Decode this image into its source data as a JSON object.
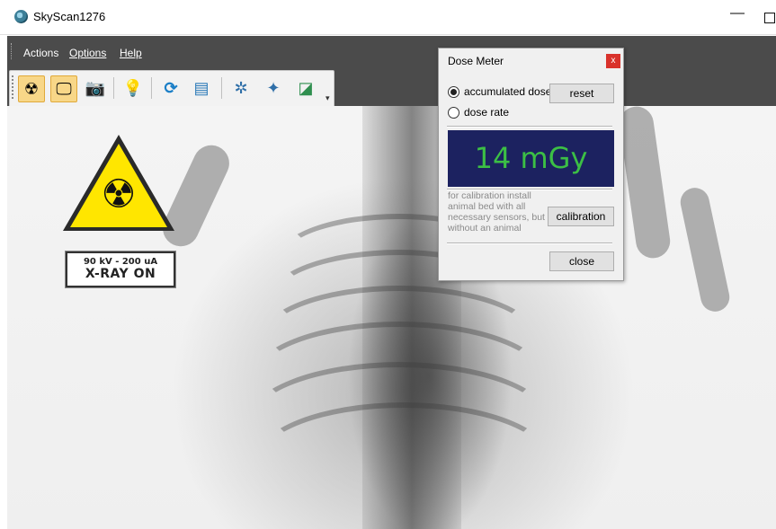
{
  "window": {
    "title": "SkyScan1276",
    "minimize_glyph": "—"
  },
  "menu": {
    "items": [
      "Actions",
      "Options",
      "Help"
    ]
  },
  "toolbar": {
    "buttons": [
      {
        "name": "radiation-icon",
        "glyph": "☢",
        "active": true
      },
      {
        "name": "monitor-icon",
        "glyph": "🖵",
        "active": true
      },
      {
        "name": "camera-icon",
        "glyph": "📷",
        "active": false
      },
      {
        "name": "lightbulb-icon",
        "glyph": "💡",
        "active": false
      },
      {
        "name": "refresh-icon",
        "glyph": "⟳",
        "active": false
      },
      {
        "name": "image-stack-icon",
        "glyph": "▤",
        "active": false
      },
      {
        "name": "fan-icon",
        "glyph": "✲",
        "active": false
      },
      {
        "name": "arrows-icon",
        "glyph": "✦",
        "active": false
      },
      {
        "name": "calibration-icon",
        "glyph": "◪",
        "active": false
      }
    ],
    "more_glyph": "▾"
  },
  "warning": {
    "radiation_glyph": "☢",
    "line1": "90 kV - 200 uA",
    "line2": "X-RAY ON"
  },
  "dose_meter": {
    "title": "Dose Meter",
    "close_x": "x",
    "mode_accumulated": "accumulated dose",
    "mode_rate": "dose rate",
    "selected_mode": "accumulated dose",
    "reset_label": "reset",
    "value": "14 mGy",
    "note": "for calibration install animal bed with all necessary sensors, but without an animal",
    "calibration_label": "calibration",
    "close_label": "close"
  },
  "colors": {
    "dose_bg": "#1c2260",
    "dose_text": "#3cbf45",
    "warning_yellow": "#ffe600",
    "active_tool": "#f8d788"
  }
}
